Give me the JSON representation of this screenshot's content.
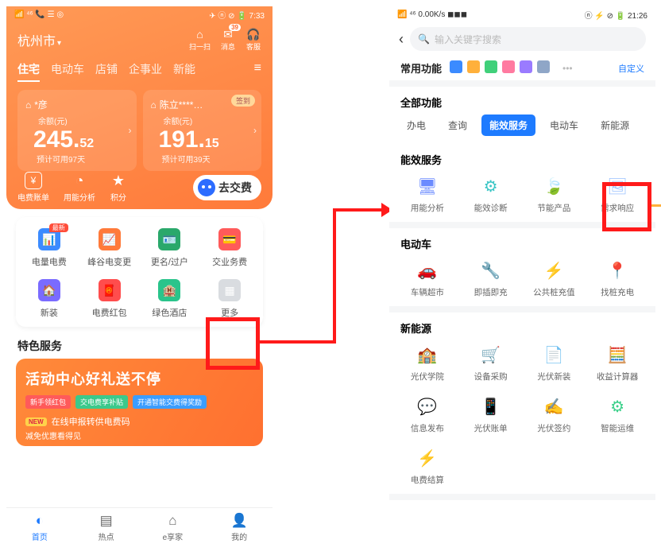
{
  "left": {
    "status": {
      "carrier": "📶 ⁴⁶ 📞 ☰ ◎",
      "right": "✈ ⓝ ⊘ 🔋 7:33"
    },
    "location": "杭州市",
    "top_icons": [
      {
        "glyph": "⌂",
        "label": "扫一扫"
      },
      {
        "glyph": "✉",
        "label": "消息",
        "badge": "39"
      },
      {
        "glyph": "🎧",
        "label": "客服"
      }
    ],
    "tabs": [
      "住宅",
      "电动车",
      "店铺",
      "企事业",
      "新能"
    ],
    "cards": [
      {
        "owner": "*彦",
        "balance_label": "余额(元)",
        "int": "245.",
        "cents": "52",
        "days": "预计可用97天"
      },
      {
        "owner": "陈立****…",
        "balance_label": "余额(元)",
        "int": "191.",
        "cents": "15",
        "days": "预计可用39天",
        "sign": "签到"
      }
    ],
    "tools": [
      {
        "label": "电费账单",
        "glyph": "¥"
      },
      {
        "label": "用能分析",
        "glyph": "◔"
      },
      {
        "label": "积分",
        "glyph": "★"
      }
    ],
    "pay_button": "去交费",
    "grid": [
      {
        "label": "电量电费",
        "color": "#3b8bff",
        "glyph": "📊",
        "new": "最新"
      },
      {
        "label": "峰谷电变更",
        "color": "#ff7a3a",
        "glyph": "📈"
      },
      {
        "label": "更名/过户",
        "color": "#2aa86b",
        "glyph": "🪪"
      },
      {
        "label": "交业务费",
        "color": "#ff5a5a",
        "glyph": "💳"
      },
      {
        "label": "新装",
        "color": "#7a6bff",
        "glyph": "🏠"
      },
      {
        "label": "电费红包",
        "color": "#ff4d4d",
        "glyph": "🧧"
      },
      {
        "label": "绿色酒店",
        "color": "#2ac48b",
        "glyph": "🏨"
      },
      {
        "label": "更多",
        "color": "#d9dce0",
        "glyph": "▦"
      }
    ],
    "section_title": "特色服务",
    "promo": {
      "big": "活动中心好礼送不停",
      "pills": [
        "新手领红包",
        "交电费享补贴",
        "开通智能交费得奖励"
      ],
      "new_label": "NEW",
      "line1": "在线申报转供电费码",
      "line2": "减免优惠看得见"
    },
    "bottom_nav": [
      {
        "label": "首页",
        "glyph": "◐",
        "active": true
      },
      {
        "label": "热点",
        "glyph": "▤"
      },
      {
        "label": "e享家",
        "glyph": "⌂"
      },
      {
        "label": "我的",
        "glyph": "👤"
      }
    ]
  },
  "right": {
    "status": {
      "left": "📶 ⁴⁶ 0.00K/s ◼◼◼",
      "right": "ⓝ ⚡ ⊘ 🔋 21:26"
    },
    "search_placeholder": "输入关键字搜索",
    "common_label": "常用功能",
    "custom_label": "自定义",
    "common_icons": [
      "#3b8bff",
      "#ffb03b",
      "#40d07a",
      "#ff7aa0",
      "#9a7bff",
      "#8fa6c7"
    ],
    "all_label": "全部功能",
    "cat_tabs": [
      "办电",
      "查询",
      "能效服务",
      "电动车",
      "新能源"
    ],
    "sections": [
      {
        "title": "能效服务",
        "items": [
          {
            "label": "用能分析",
            "color": "#6b8bff",
            "glyph": "🖥"
          },
          {
            "label": "能效诊断",
            "color": "#3bc6c6",
            "glyph": "⚙"
          },
          {
            "label": "节能产品",
            "color": "#3bd08a",
            "glyph": "🍃"
          },
          {
            "label": "需求响应",
            "color": "#9cc3ff",
            "glyph": "🖼"
          }
        ]
      },
      {
        "title": "电动车",
        "items": [
          {
            "label": "车辆超市",
            "color": "#b87bff",
            "glyph": "🚗"
          },
          {
            "label": "即插即充",
            "color": "#3bd08a",
            "glyph": "🔧"
          },
          {
            "label": "公共桩充值",
            "color": "#2a9bff",
            "glyph": "⚡"
          },
          {
            "label": "找桩充电",
            "color": "#2a9bff",
            "glyph": "📍"
          }
        ]
      },
      {
        "title": "新能源",
        "items": [
          {
            "label": "光伏学院",
            "color": "#ff9a3a",
            "glyph": "🏫"
          },
          {
            "label": "设备采购",
            "color": "#3b8bff",
            "glyph": "🛒"
          },
          {
            "label": "光伏新装",
            "color": "#ffb03b",
            "glyph": "📄"
          },
          {
            "label": "收益计算器",
            "color": "#ff9a3a",
            "glyph": "🧮"
          },
          {
            "label": "信息发布",
            "color": "#3b8bff",
            "glyph": "💬"
          },
          {
            "label": "光伏账单",
            "color": "#3bd0c6",
            "glyph": "📱"
          },
          {
            "label": "光伏签约",
            "color": "#3b8bff",
            "glyph": "✍"
          },
          {
            "label": "智能运维",
            "color": "#3bd08a",
            "glyph": "⚙"
          },
          {
            "label": "电费结算",
            "color": "#8fd94a",
            "glyph": "⚡"
          }
        ]
      }
    ]
  }
}
